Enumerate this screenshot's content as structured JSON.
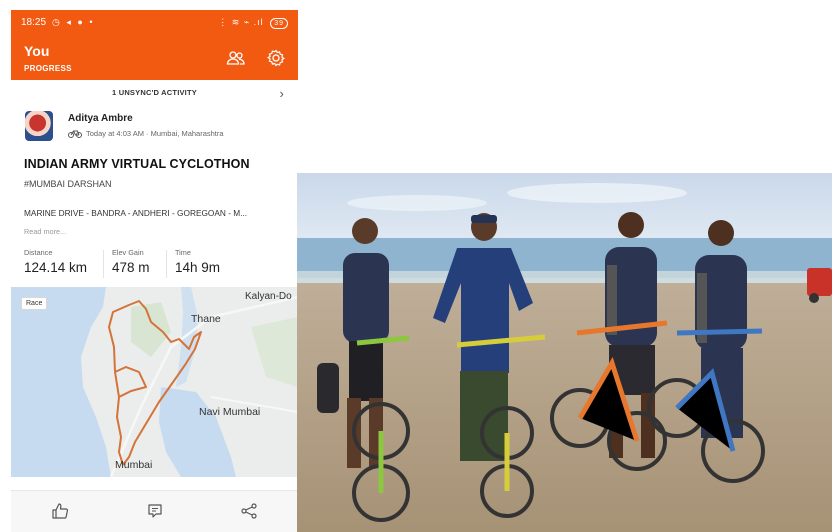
{
  "status_bar": {
    "time": "18:25",
    "left_icons": "◷ ◂ ● •",
    "right_icons": "⋮ ≋ ⌁ .ıl",
    "battery": "39"
  },
  "app_bar": {
    "title": "You",
    "subtitle": "PROGRESS"
  },
  "unsync": {
    "label": "1 UNSYNC'D ACTIVITY",
    "chevron": "›"
  },
  "athlete": {
    "name": "Aditya Ambre",
    "meta": "Today at 4:03 AM · Mumbai, Maharashtra",
    "activity_icon": "bike-icon"
  },
  "activity": {
    "title": "INDIAN ARMY VIRTUAL CYCLOTHON",
    "hashtag": "#MUMBAI DARSHAN",
    "route": "MARINE DRIVE - BANDRA - ANDHERI - GOREGOAN - M...",
    "read_more": "Read more..."
  },
  "stats": [
    {
      "label": "Distance",
      "value": "124.14 km"
    },
    {
      "label": "Elev Gain",
      "value": "478 m"
    },
    {
      "label": "Time",
      "value": "14h 9m"
    }
  ],
  "map": {
    "badge": "Race",
    "labels": {
      "kalyan": "Kalyan-Do",
      "thane": "Thane",
      "navi": "Navi Mumbai",
      "mumbai": "Mumbai"
    },
    "route_color": "#d4733a"
  },
  "actions": [
    "like-icon",
    "comment-icon",
    "share-icon"
  ],
  "colors": {
    "brand": "#f25a12"
  }
}
